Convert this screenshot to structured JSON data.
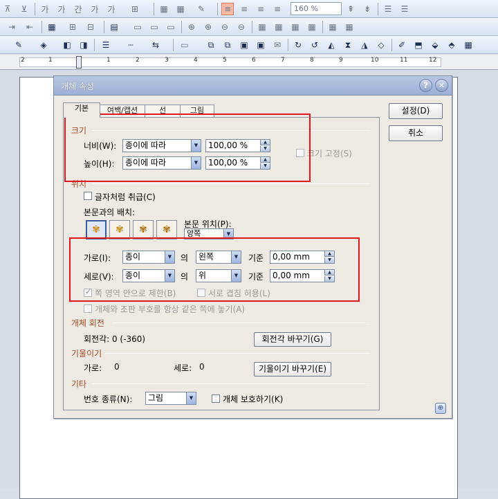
{
  "toolbar": {
    "zoom": "160 %"
  },
  "ruler": {
    "numbers": [
      "2",
      "1",
      "1",
      "2",
      "3",
      "4",
      "5",
      "6",
      "7",
      "8",
      "9",
      "10",
      "11",
      "12"
    ]
  },
  "dialog": {
    "title": "개체 속성",
    "help_glyph": "?",
    "close_glyph": "✕",
    "buttons": {
      "ok": "설정(D)",
      "cancel": "취소"
    },
    "tabs": [
      "기본",
      "여백/캡션",
      "선",
      "그림"
    ],
    "size": {
      "header": "크기",
      "width_label": "너비(W):",
      "width_mode": "종이에 따라",
      "width_value": "100,00 %",
      "height_label": "높이(H):",
      "height_mode": "종이에 따라",
      "height_value": "100,00 %",
      "fix_ratio": "크기 고정(S)"
    },
    "position": {
      "header": "위치",
      "treat_as_char": "글자처럼 취급(C)",
      "layout_label": "본문과의 배치:",
      "text_pos_label": "본문 위치(P):",
      "text_pos_value": "양쪽",
      "horiz_label": "가로(I):",
      "horiz_ref": "종이",
      "of1": "의",
      "horiz_align": "왼쪽",
      "basis1": "기준",
      "horiz_offset": "0,00 mm",
      "vert_label": "세로(V):",
      "vert_ref": "종이",
      "of2": "의",
      "vert_align": "위",
      "basis2": "기준",
      "vert_offset": "0,00 mm",
      "restrict_area": "쪽 영역 안으로 제한(B)",
      "allow_overlap": "서로 겹침 허용(L)",
      "same_page": "개체와 조판 부호를 항상 같은 쪽에 놓기(A)"
    },
    "rotation": {
      "header": "개체 회전",
      "angle_text": "회전각: 0 (-360)",
      "button": "회전각 바꾸기(G)"
    },
    "skew": {
      "header": "기울이기",
      "h_label": "가로:",
      "h_value": "0",
      "v_label": "세로:",
      "v_value": "0",
      "button": "기울이기 바꾸기(E)"
    },
    "etc": {
      "header": "기타",
      "number_kind_label": "번호 종류(N):",
      "number_kind_value": "그림",
      "protect": "개체 보호하기(K)"
    }
  },
  "colors": {
    "section_header": "#a64c26",
    "annotation_red": "#e2141c"
  }
}
